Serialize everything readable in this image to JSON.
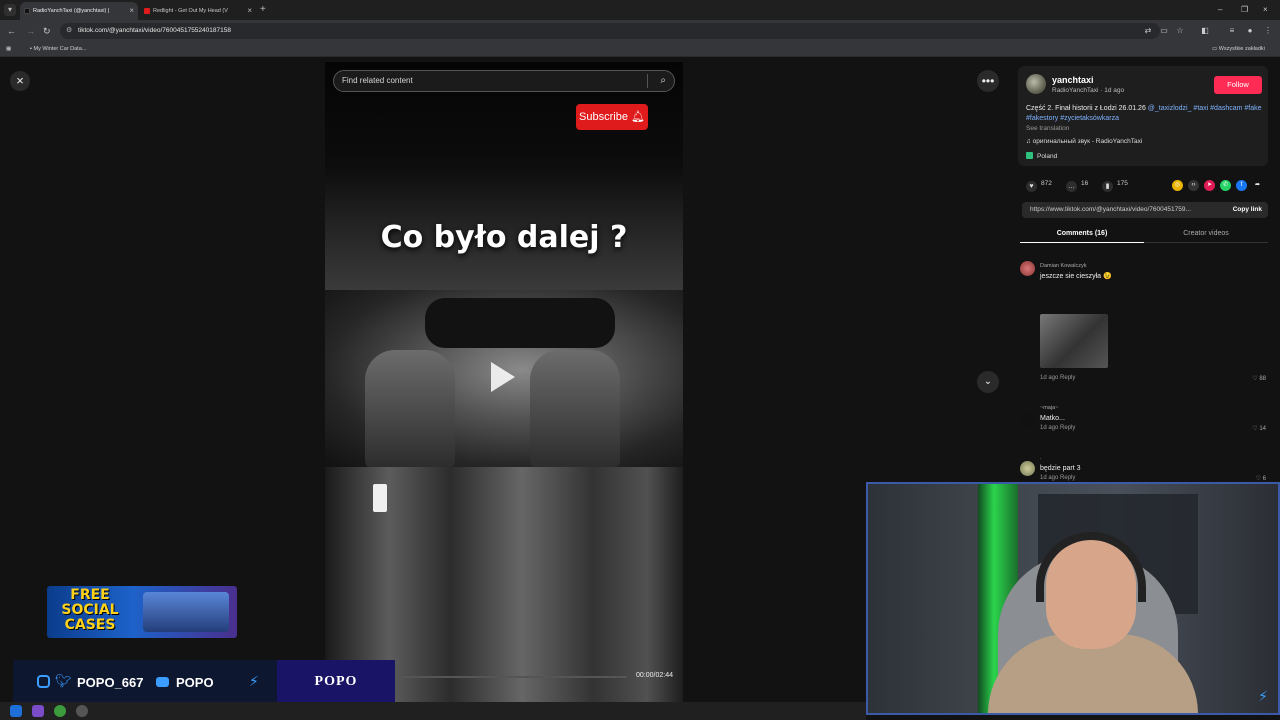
{
  "browser": {
    "tabs": [
      {
        "title": "RadioYanchTaxi (@yanchtaxi) |",
        "active": true
      },
      {
        "title": "Redlight - Get Out My Head (V",
        "active": false
      }
    ],
    "url": "tiktok.com/@yanchtaxi/video/7600451755240187158",
    "bookmarks": {
      "item": "My Winter Car Data...",
      "all": "Wszystkie zakładki"
    }
  },
  "video": {
    "search_placeholder": "Find related content",
    "subscribe_label": "Subscribe",
    "overlay_text": "Co było dalej ?",
    "time": "00:00/02:44",
    "progress": 0
  },
  "post": {
    "username": "yanchtaxi",
    "subline": "RadioYanchTaxi · 1d ago",
    "follow_label": "Follow",
    "caption_text": "Część 2. Finał historii z Łodzi 26.01.26 ",
    "caption_tags": "@_taxizlodzi_ #taxi #dashcam #fake #fakestory #zycietaksówkarza",
    "see_translation": "See translation",
    "sound": "♫ оригинальный звук - RadioYanchTaxi",
    "location": "Poland",
    "likes": "872",
    "comments_count": "16",
    "saves": "175",
    "link": "https://www.tiktok.com/@yanchtaxi/video/7600451759...",
    "copy_label": "Copy link",
    "tab_comments": "Comments (16)",
    "tab_creator": "Creator videos"
  },
  "comments": [
    {
      "name": "Damian Kowalczyk",
      "text": "jeszcze sie cieszyła 😉",
      "meta": "1d ago   Reply",
      "likes": "88"
    },
    {
      "name": "~maja~",
      "text": "Matko...",
      "meta": "1d ago   Reply",
      "likes": "14"
    },
    {
      "name": ".",
      "text": "będzie part 3",
      "meta": "1d ago   Reply",
      "likes": "6"
    }
  ],
  "overlay": {
    "promo_text": "FREE SOCIAL CASES",
    "handle1": "POPO_667",
    "handle2": "POPO",
    "brand": "POPO"
  },
  "colors": {
    "follow": "#fe2c55",
    "subscribe": "#e01b1b",
    "accent": "#3b9dff"
  }
}
